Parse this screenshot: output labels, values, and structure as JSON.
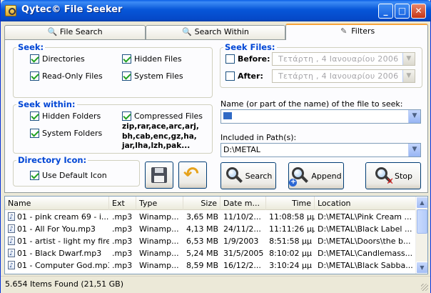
{
  "window": {
    "title": "Qytec© File Seeker"
  },
  "tabs": [
    {
      "label": "File Search",
      "icon": "magnifier-icon"
    },
    {
      "label": "Search Within",
      "icon": "magnifier-doc-icon"
    },
    {
      "label": "Filters",
      "icon": "wand-icon"
    }
  ],
  "seek": {
    "legend": "Seek:",
    "directories": "Directories",
    "hidden_files": "Hidden Files",
    "read_only_files": "Read-Only Files",
    "system_files": "System Files"
  },
  "seek_within": {
    "legend": "Seek within:",
    "hidden_folders": "Hidden Folders",
    "system_folders": "System Folders",
    "compressed_files": "Compressed Files",
    "extensions_line1": "zip,rar,ace,arc,arj,",
    "extensions_line2": "bh,cab,enc,gz,ha,",
    "extensions_line3": "jar,lha,lzh,pak..."
  },
  "directory_icon": {
    "legend": "Directory Icon:",
    "use_default": "Use Default Icon"
  },
  "seek_files": {
    "legend": "Seek Files:",
    "before_label": "Before:",
    "before_value": "Τετάρτη  ,   4  Ιανουαρίου  2006",
    "after_label": "After:",
    "after_value": "Τετάρτη  ,   4  Ιανουαρίου  2006"
  },
  "name_field": {
    "label": "Name (or part of the name) of the file to seek:",
    "value": ""
  },
  "path_field": {
    "label": "Included in Path(s):",
    "value": "D:\\METAL"
  },
  "buttons": {
    "search": "Search",
    "append": "Append",
    "stop": "Stop"
  },
  "table": {
    "columns": [
      "Name",
      "Ext",
      "Type",
      "Size",
      "Date m...",
      "Time",
      "Location"
    ],
    "rows": [
      [
        "01 - pink cream 69 - i...",
        ".mp3",
        "Winamp...",
        "3,65 MB",
        "11/10/2...",
        "11:08:58 μμ",
        "D:\\METAL\\Pink Cream ..."
      ],
      [
        "01 - All For You.mp3",
        ".mp3",
        "Winamp...",
        "4,13 MB",
        "24/11/2...",
        "11:11:26 μμ",
        "D:\\METAL\\Black Label ..."
      ],
      [
        "01 - artist - light my fire....",
        ".mp3",
        "Winamp...",
        "6,53 MB",
        "1/9/2003",
        "8:51:58 μμ",
        "D:\\METAL\\Doors\\the b..."
      ],
      [
        "01 - Black Dwarf.mp3",
        ".mp3",
        "Winamp...",
        "5,24 MB",
        "31/5/2005",
        "8:10:02 μμ",
        "D:\\METAL\\Candlemass..."
      ],
      [
        "01 - Computer God.mp3",
        ".mp3",
        "Winamp...",
        "8,59 MB",
        "16/12/2...",
        "3:10:24 μμ",
        "D:\\METAL\\Black Sabba..."
      ]
    ]
  },
  "status": {
    "text": "5.654 Items Found (21,51 GB)"
  },
  "colors": {
    "title_bar": "#0756d8",
    "legend_text": "#0046d5",
    "active_tab_accent": "#f7a43a"
  }
}
